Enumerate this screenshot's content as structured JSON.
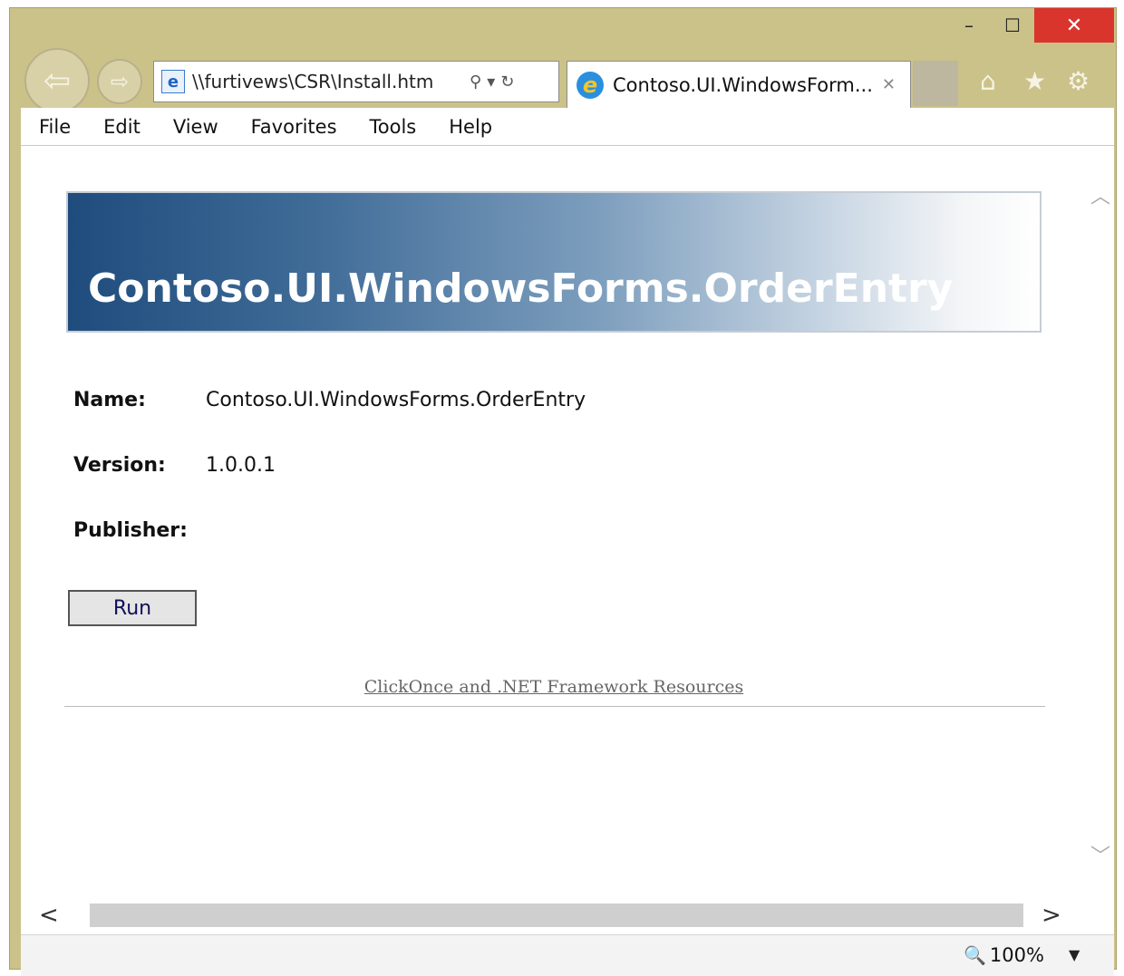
{
  "window": {
    "minimize_glyph": "–",
    "maximize_glyph": "☐",
    "close_glyph": "✕"
  },
  "nav": {
    "back_glyph": "⇦",
    "forward_glyph": "⇨",
    "address": "\\\\furtivews\\CSR\\Install.htm",
    "search_glyph": "⚲",
    "dropdown_glyph": "▾",
    "refresh_glyph": "↻",
    "page_icon_glyph": "e"
  },
  "tab": {
    "icon_glyph": "e",
    "title": "Contoso.UI.WindowsForm...",
    "close_glyph": "✕"
  },
  "toolbar": {
    "home_glyph": "⌂",
    "favorites_glyph": "★",
    "settings_glyph": "⚙"
  },
  "menu": {
    "items": [
      "File",
      "Edit",
      "View",
      "Favorites",
      "Tools",
      "Help"
    ]
  },
  "page": {
    "banner_title": "Contoso.UI.WindowsForms.OrderEntry",
    "name_label": "Name:",
    "name_value": "Contoso.UI.WindowsForms.OrderEntry",
    "version_label": "Version:",
    "version_value": "1.0.0.1",
    "publisher_label": "Publisher:",
    "publisher_value": "",
    "run_label": "Run",
    "resources_link": "ClickOnce and .NET Framework Resources"
  },
  "scrollbars": {
    "up_glyph": "︿",
    "down_glyph": "﹀",
    "left_glyph": "<",
    "right_glyph": ">"
  },
  "status": {
    "zoom_glyph": "🔍",
    "zoom": "100%",
    "zoom_dropdown_glyph": "▼"
  },
  "colors": {
    "frame": "#cbc28a",
    "close_button": "#d9352d",
    "banner_dark": "#1f4c7d",
    "link": "#666666"
  }
}
